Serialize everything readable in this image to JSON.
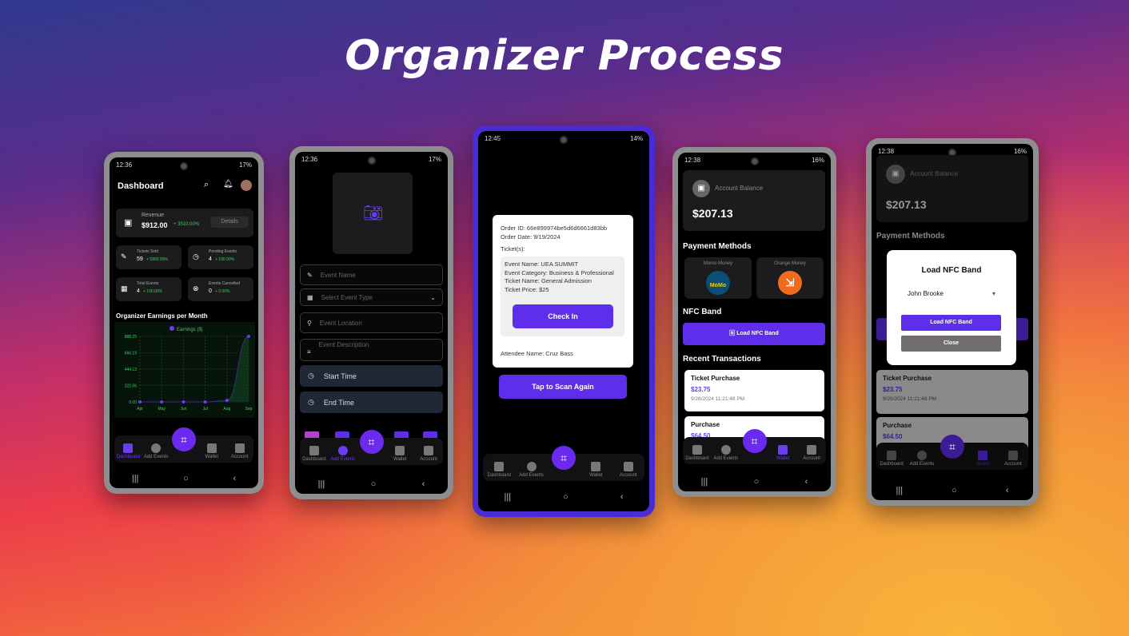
{
  "title": "Organizer Process",
  "nav": {
    "dashboard": "Dashboard",
    "add_events": "Add Events",
    "wallet": "Wallet",
    "account": "Account"
  },
  "phones": [
    {
      "time": "12:36",
      "battery": "17%"
    },
    {
      "time": "12:36",
      "battery": "17%"
    },
    {
      "time": "12:45",
      "battery": "14%"
    },
    {
      "time": "12:38",
      "battery": "16%"
    },
    {
      "time": "12:38",
      "battery": "16%"
    }
  ],
  "dashboard": {
    "header": "Dashboard",
    "revenue": {
      "label": "Revenue",
      "value": "$912.00",
      "change": "+ 3510.00%",
      "details": "Details"
    },
    "stats": [
      {
        "label": "Tickets Sold",
        "value": "59",
        "change": "+ 5800.00%"
      },
      {
        "label": "Pending Events",
        "value": "4",
        "change": "+ 100.00%"
      },
      {
        "label": "Total Events",
        "value": "4",
        "change": "+ 100.00%"
      },
      {
        "label": "Events Cancelled",
        "value": "0",
        "change": "+ 0.00%"
      }
    ],
    "chart_title": "Organizer Earnings per Month"
  },
  "chart_data": {
    "type": "line",
    "title": "Organizer Earnings per Month",
    "legend": "Earnings ($)",
    "legend_position": "top",
    "categories": [
      "Apr",
      "May",
      "Jun",
      "Jul",
      "Aug",
      "Sep"
    ],
    "values": [
      0,
      0,
      0,
      0,
      20,
      888.25
    ],
    "yticks": [
      "0.00",
      "222.06",
      "444.13",
      "666.19",
      "888.25"
    ],
    "ylim": [
      0,
      888.25
    ],
    "grid": true,
    "color": "#6a3df0"
  },
  "add_event": {
    "fields": [
      "Event Name",
      "Select Event Type",
      "Event Location",
      "Event Description"
    ],
    "start_time": "Start Time",
    "end_time": "End Time"
  },
  "checkin": {
    "order_id": "Order ID: 66e899974be5d6d6661d83bb",
    "order_date": "Order Date: 9/19/2024",
    "tickets_label": "Ticket(s):",
    "event_name": "Event Name: UEA SUMMIT",
    "event_category": "Event Category: Business & Professional",
    "ticket_name": "Ticket Name: General Admission",
    "ticket_price": "Ticket Price: $25",
    "check_in": "Check In",
    "attendee": "Attendee Name: Cruz Bass",
    "scan_again": "Tap to Scan Again"
  },
  "wallet": {
    "balance_label": "Account Balance",
    "balance": "$207.13",
    "payment_methods": "Payment Methods",
    "methods": [
      "Momo Money",
      "Orange Money"
    ],
    "momo_logo": "MoMo",
    "nfc_title": "NFC Band",
    "load_nfc": "Load NFC Band",
    "recent": "Recent Transactions",
    "transactions": [
      {
        "title": "Ticket Purchase",
        "amount": "$23.75",
        "date": "9/26/2024 11:21:48 PM"
      },
      {
        "title": "Purchase",
        "amount": "$64.50"
      }
    ]
  },
  "dialog": {
    "title": "Load NFC Band",
    "selected": "John Brooke",
    "load": "Load NFC Band",
    "close": "Close"
  }
}
